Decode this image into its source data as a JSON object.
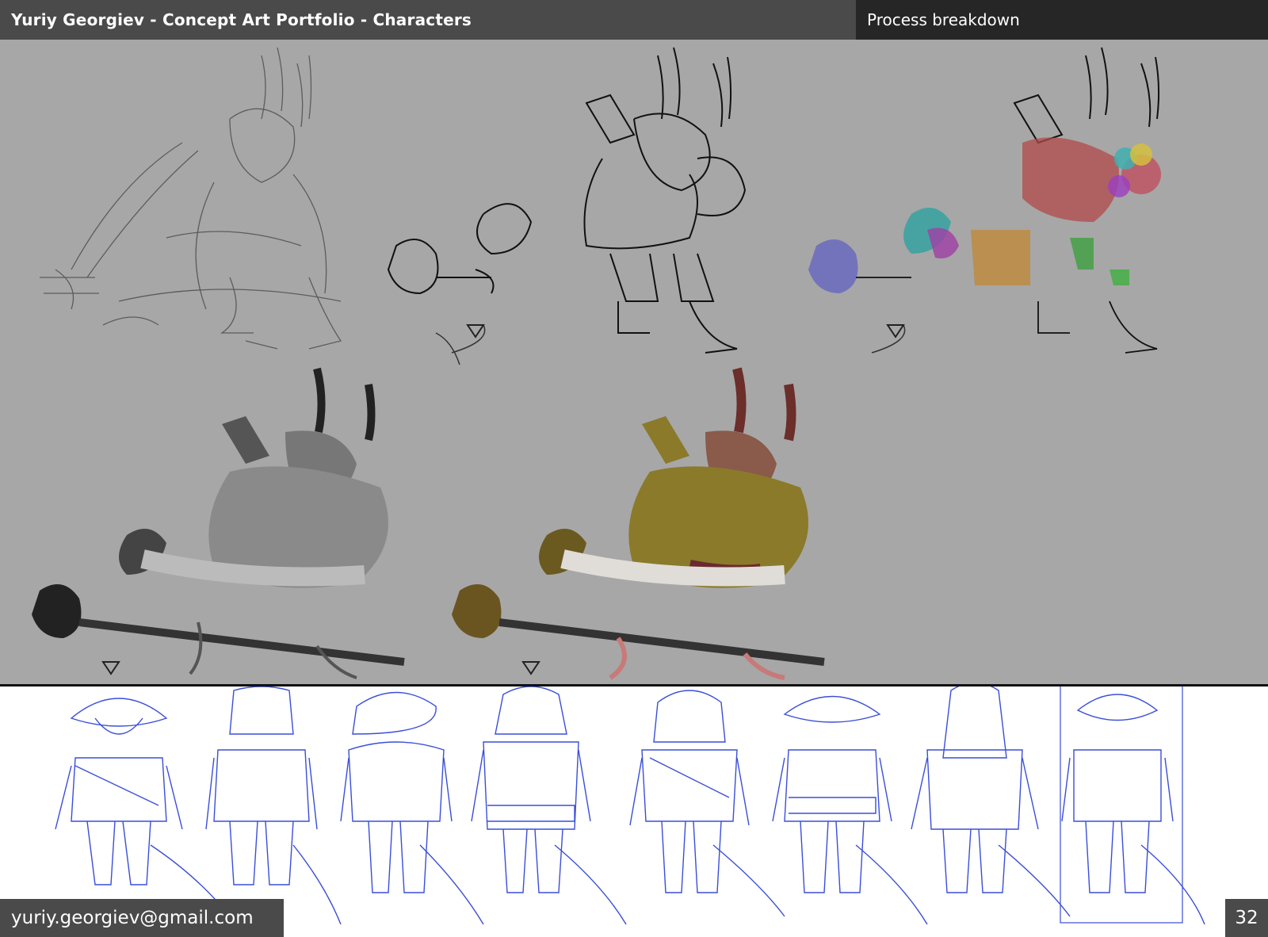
{
  "header": {
    "title": "Yuriy Georgiev - Concept Art Portfolio - Characters",
    "subtitle": "Process breakdown"
  },
  "footer": {
    "email": "yuriy.georgiev@gmail.com",
    "page_number": "32"
  },
  "colors": {
    "header_bg": "#4a4a4a",
    "header_right_bg": "#262626",
    "canvas_bg": "#a7a7a7",
    "lineup_stroke": "#3a4ed8",
    "armor_gold": "#8a7a2a",
    "horn_red": "#6b2e2a"
  },
  "illustrations": {
    "stages": [
      {
        "name": "rough-gesture-sketch"
      },
      {
        "name": "line-sketch"
      },
      {
        "name": "color-block-sketch"
      },
      {
        "name": "grayscale-render"
      },
      {
        "name": "color-render"
      }
    ],
    "lineup_count": 8
  }
}
